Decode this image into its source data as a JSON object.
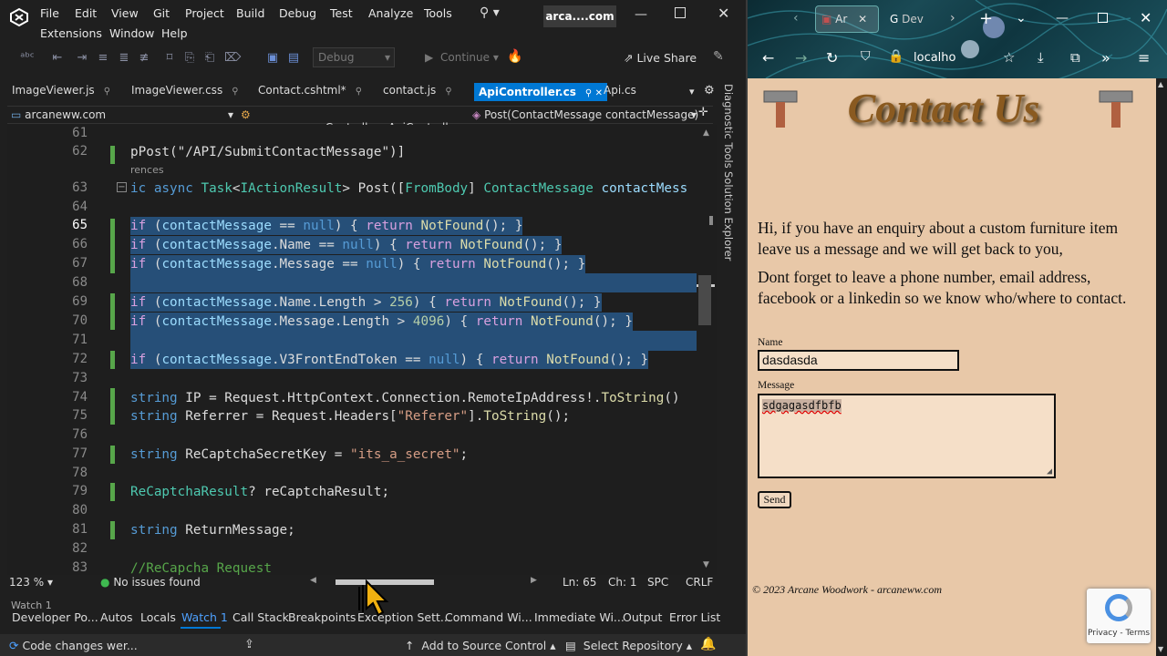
{
  "vs": {
    "menu": [
      "File",
      "Edit",
      "View",
      "Git",
      "Project",
      "Build",
      "Debug",
      "Test",
      "Analyze",
      "Tools"
    ],
    "menu2": [
      "Extensions",
      "Window",
      "Help"
    ],
    "title": "arca....com",
    "config": "Debug",
    "continue": "Continue",
    "live_share": "Live Share",
    "tabs": [
      "ImageViewer.js",
      "ImageViewer.css",
      "Contact.cshtml*",
      "contact.js",
      "ApiController.cs",
      "Api.cs"
    ],
    "side_tabs": [
      "Diagnostic Tools",
      "Solution Explorer"
    ],
    "nav": {
      "project": "arcanеww.com",
      "class": "arcanеww.com.Controllers.ApiController",
      "member": "Post(ContactMessage contactMessage)"
    },
    "refs": "rences",
    "lines": [
      "61",
      "62",
      "",
      "63",
      "64",
      "65",
      "66",
      "67",
      "68",
      "69",
      "70",
      "71",
      "72",
      "73",
      "74",
      "75",
      "76",
      "77",
      "78",
      "79",
      "80",
      "81",
      "82",
      "83"
    ],
    "code": {
      "l62": "pPost(\"/API/SubmitContactMessage\")]",
      "l63a": "ic async ",
      "l63b": "Task",
      "l63c": "<",
      "l63d": "IActionResult",
      "l63e": "> Post([",
      "l63f": "FromBody",
      "l63g": "] ",
      "l63h": "ContactMessage",
      "l63i": " contactMess",
      "l65": "if (contactMessage == null) { return NotFound(); }",
      "l66": "if (contactMessage.Name == null) { return NotFound(); }",
      "l67": "if (contactMessage.Message == null) { return NotFound(); }",
      "l69": "if (contactMessage.Name.Length > 256) { return NotFound(); }",
      "l70": "if (contactMessage.Message.Length > 4096) { return NotFound(); }",
      "l72": "if (contactMessage.V3FrontEndToken == null) { return NotFound(); }",
      "l74": "string IP = Request.HttpContext.Connection.RemoteIpAddress!.ToString()",
      "l75": "string Referrer = Request.Headers[\"Referer\"].ToString();",
      "l77": "string ReCaptchaSecretKey = \"its_a_secret\";",
      "l79": "ReCaptchaResult? reCaptchaResult;",
      "l81": "string ReturnMessage;",
      "l83": "//ReCapcha Request"
    },
    "statusbar": {
      "zoom": "123 %",
      "issues": "No issues found",
      "ln": "Ln: 65",
      "ch": "Ch: 1",
      "spc": "SPC",
      "crlf": "CRLF"
    },
    "watch": "Watch 1",
    "bottom_tabs": [
      "Developer Po...",
      "Autos",
      "Locals",
      "Watch 1",
      "Call Stack",
      "Breakpoints",
      "Exception Sett...",
      "Command Wi...",
      "Immediate Wi...",
      "Output",
      "Error List"
    ],
    "footer": {
      "changes": "Code changes wer...",
      "source": "Add to Source Control",
      "repo": "Select Repository"
    },
    "accent": "#0078d4"
  },
  "ff": {
    "url": "localho",
    "tab_title": "Ar",
    "tab2_title": "Dev",
    "page": {
      "heading": "Contact Us",
      "p1": "Hi, if you have an enquiry about a custom furniture item leave us a message and we will get back to you,",
      "p2": "Dont forget to leave a phone number, email address, facebook or a linkedin so we know who/where to contact.",
      "name_label": "Name",
      "name_value": "dasdasda",
      "message_label": "Message",
      "message_value": "sdgagasdfbfb",
      "send": "Send",
      "footer": "© 2023 Arcane Woodwork - arcaneww.com",
      "recaptcha": "Privacy - Terms"
    }
  }
}
